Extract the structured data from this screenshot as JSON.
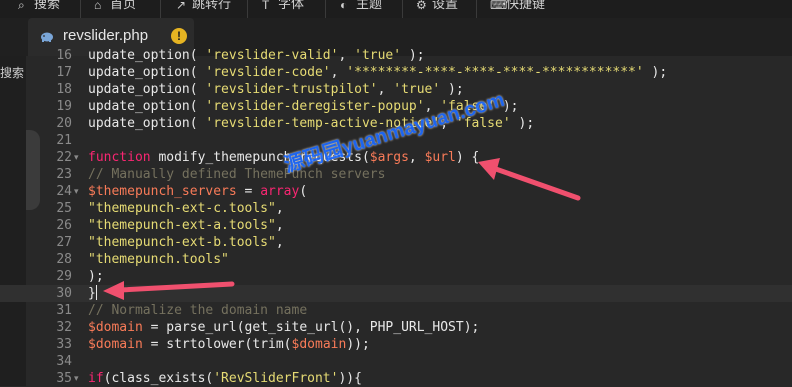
{
  "toolbar": {
    "items": [
      {
        "label": "搜索",
        "icon": "search-icon"
      },
      {
        "label": "首页",
        "icon": "home-icon"
      },
      {
        "label": "跳转行",
        "icon": "jump-icon"
      },
      {
        "label": "字体",
        "icon": "font-icon"
      },
      {
        "label": "主题",
        "icon": "theme-icon"
      },
      {
        "label": "设置",
        "icon": "gear-icon"
      },
      {
        "label": "快捷键",
        "icon": "keyboard-icon"
      }
    ]
  },
  "tab": {
    "filename": "revslider.php",
    "icon": "php-elephant-icon",
    "status": "!"
  },
  "left_panel": {
    "label": "搜索"
  },
  "editor": {
    "lines": [
      {
        "n": "16",
        "text": "update_option( 'revslider-valid', 'true' );"
      },
      {
        "n": "17",
        "text": "update_option( 'revslider-code', '********-****-****-****-************' );"
      },
      {
        "n": "18",
        "text": "update_option( 'revslider-trustpilot', 'true' );"
      },
      {
        "n": "19",
        "text": "update_option( 'revslider-deregister-popup', 'false' );"
      },
      {
        "n": "20",
        "text": "update_option( 'revslider-temp-active-notice', 'false' );"
      },
      {
        "n": "21",
        "text": ""
      },
      {
        "n": "22",
        "text": "function modify_themepunch_requests($args, $url) {",
        "fold": true
      },
      {
        "n": "23",
        "text": "// Manually defined ThemePunch servers"
      },
      {
        "n": "24",
        "text": "$themepunch_servers = array(",
        "fold": true
      },
      {
        "n": "25",
        "text": "\"themepunch-ext-c.tools\","
      },
      {
        "n": "26",
        "text": "\"themepunch-ext-a.tools\","
      },
      {
        "n": "27",
        "text": "\"themepunch-ext-b.tools\","
      },
      {
        "n": "28",
        "text": "\"themepunch.tools\""
      },
      {
        "n": "29",
        "text": ");"
      },
      {
        "n": "30",
        "text": "}",
        "highlight": true
      },
      {
        "n": "31",
        "text": "// Normalize the domain name"
      },
      {
        "n": "32",
        "text": "$domain = parse_url(get_site_url(), PHP_URL_HOST);"
      },
      {
        "n": "33",
        "text": "$domain = strtolower(trim($domain));"
      },
      {
        "n": "34",
        "text": ""
      },
      {
        "n": "35",
        "text": "if(class_exists('RevSliderFront')){",
        "fold": true
      }
    ]
  },
  "watermark": {
    "text": "源码园yuanmayuan.com"
  },
  "colors": {
    "background": "#282828",
    "string": "#e6db74",
    "keyword": "#f92672",
    "variable": "#f97b58",
    "comment": "#75715e",
    "arrow": "#f0506e",
    "watermark": "#1e6bff"
  }
}
